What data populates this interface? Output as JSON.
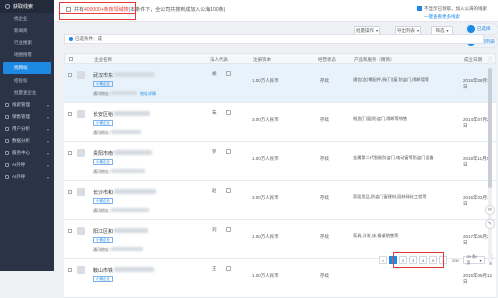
{
  "sidebar": {
    "header": "获取线索",
    "items": [
      {
        "label": "找企业",
        "active": false
      },
      {
        "label": "新闻商",
        "active": false
      },
      {
        "label": "行业搜索",
        "active": false
      },
      {
        "label": "地图搜客",
        "active": false
      },
      {
        "label": "找网站",
        "active": true
      },
      {
        "label": "招投标",
        "active": false
      },
      {
        "label": "批量查企业",
        "active": false
      }
    ],
    "groups": [
      {
        "label": "线索管理"
      },
      {
        "label": "销售管理"
      },
      {
        "label": "用户分析"
      },
      {
        "label": "数据分析"
      },
      {
        "label": "服务中心"
      },
      {
        "label": "AI外呼"
      },
      {
        "label": "AI外呼"
      }
    ]
  },
  "topbar": {
    "result_prefix": "共有",
    "result_count": "400000+条按领域搜",
    "result_suffix": "(本条件下，全公司共搜到成加入公海100条)",
    "right_check": "不显示已领取，加入公海的线索",
    "link": "一键查看更多线索",
    "btn_batch": "批量操作",
    "btn_export": "导出列表",
    "btn_filter": "筛选",
    "float_1": "已选择",
    "float_2": "全部列表"
  },
  "filter": {
    "tag": "已选条件：成"
  },
  "table": {
    "headers": {
      "company": "企业名称",
      "rep": "法人代表",
      "capital": "注册资本",
      "status": "经营状态",
      "scope": "产品和服务（精简）",
      "date": "成立日期"
    },
    "rows": [
      {
        "name": "武汉市东",
        "badge": "小微企业",
        "sub": "通讯地址：",
        "sub_link": "地址详情",
        "rep": "胡",
        "capital": "1.00万人民币",
        "status": "存续",
        "scope": "通信(含)零配件,厨(门)窗,防盗门,隔断墙等",
        "date": "2016年08月10日",
        "selected": true
      },
      {
        "name": "长安区稻",
        "badge": "小微企业",
        "sub": "通讯地址：",
        "sub_link": "",
        "rep": "朱",
        "capital": "3.00万人民币",
        "status": "存续",
        "scope": "制造(门窗)防盗门,隔断等销售",
        "date": "2014年07月22日",
        "selected": false
      },
      {
        "name": "贵阳市南",
        "badge": "小微企业",
        "sub": "通讯地址：",
        "sub_link": "",
        "rep": "罗",
        "capital": "1.00万人民币",
        "status": "存续",
        "scope": "金属第二代智能防盗门,电动窗等防盗门设备",
        "date": "2018年11月03日",
        "selected": false
      },
      {
        "name": "长沙市和",
        "badge": "小微企业",
        "sub": "通讯地址：",
        "sub_link": "",
        "rep": "赵",
        "capital": "3.00万人民币",
        "status": "存续",
        "scope": "家居用品,防盗门窗建材,园林绿化工程等",
        "date": "2016年02月18日",
        "selected": false
      },
      {
        "name": "阳江区和",
        "badge": "小微企业",
        "sub": "通讯地址：",
        "sub_link": "",
        "rep": "刘",
        "capital": "1.00万人民币",
        "status": "存续",
        "scope": "家具,沙发,床,餐桌销售等",
        "date": "2017年05月26日",
        "selected": false
      },
      {
        "name": "鞍山市铁",
        "badge": "小微企业",
        "sub": "通讯地址：",
        "sub_link": "",
        "rep": "王",
        "capital": "1.00万人民币",
        "status": "存续",
        "scope": "",
        "date": "2015年09月12日",
        "selected": false
      }
    ]
  },
  "pagination": {
    "pages": [
      "1",
      "2",
      "3",
      "4",
      "5"
    ],
    "active": "1",
    "next": ">",
    "total": "200",
    "per_page": "20 条/页",
    "goto": "跳至"
  }
}
